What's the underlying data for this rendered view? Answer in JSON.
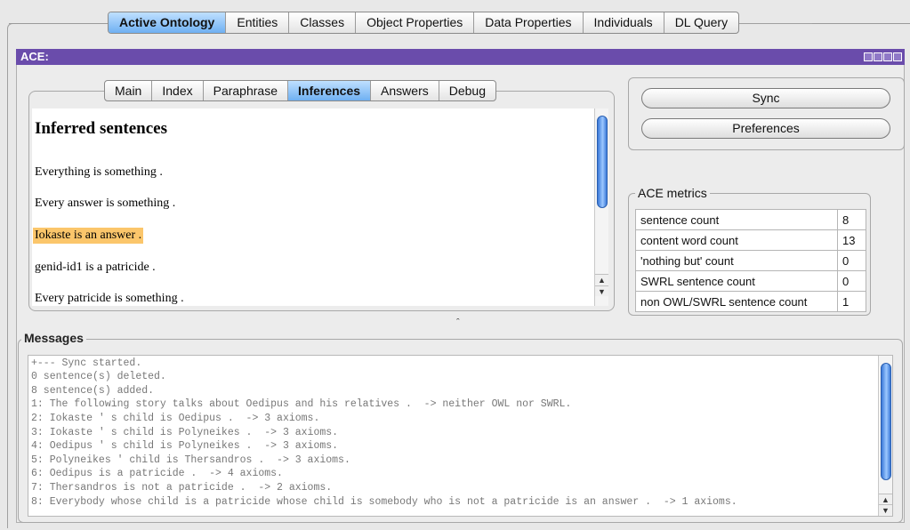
{
  "top_tabs": [
    "Active Ontology",
    "Entities",
    "Classes",
    "Object Properties",
    "Data Properties",
    "Individuals",
    "DL Query"
  ],
  "view": {
    "title": "ACE:"
  },
  "inner_tabs": [
    "Main",
    "Index",
    "Paraphrase",
    "Inferences",
    "Answers",
    "Debug"
  ],
  "sentences": {
    "heading": "Inferred sentences",
    "items": [
      "Everything is something .",
      "Every answer is something .",
      "Iokaste is an answer .",
      "genid-id1 is a patricide .",
      "Every patricide is something ."
    ]
  },
  "buttons": {
    "sync": "Sync",
    "preferences": "Preferences"
  },
  "metrics": {
    "title": "ACE metrics",
    "rows": [
      {
        "key": "sentence count",
        "value": "8"
      },
      {
        "key": "content word count",
        "value": "13"
      },
      {
        "key": "'nothing but' count",
        "value": "0"
      },
      {
        "key": "SWRL sentence count",
        "value": "0"
      },
      {
        "key": "non OWL/SWRL sentence count",
        "value": "1"
      }
    ]
  },
  "messages": {
    "title": "Messages",
    "lines": [
      "+--- Sync started.",
      "0 sentence(s) deleted.",
      "8 sentence(s) added.",
      "1: The following story talks about Oedipus and his relatives .  -> neither OWL nor SWRL.",
      "2: Iokaste ' s child is Oedipus .  -> 3 axioms.",
      "3: Iokaste ' s child is Polyneikes .  -> 3 axioms.",
      "4: Oedipus ' s child is Polyneikes .  -> 3 axioms.",
      "5: Polyneikes ' child is Thersandros .  -> 3 axioms.",
      "6: Oedipus is a patricide .  -> 4 axioms.",
      "7: Thersandros is not a patricide .  -> 2 axioms.",
      "8: Everybody whose child is a patricide whose child is somebody who is not a patricide is an answer .  -> 1 axioms."
    ]
  },
  "colors": {
    "accent_purple": "#6a4cab",
    "tab_active": "#6fb0f2",
    "highlight": "#fbc66b"
  }
}
